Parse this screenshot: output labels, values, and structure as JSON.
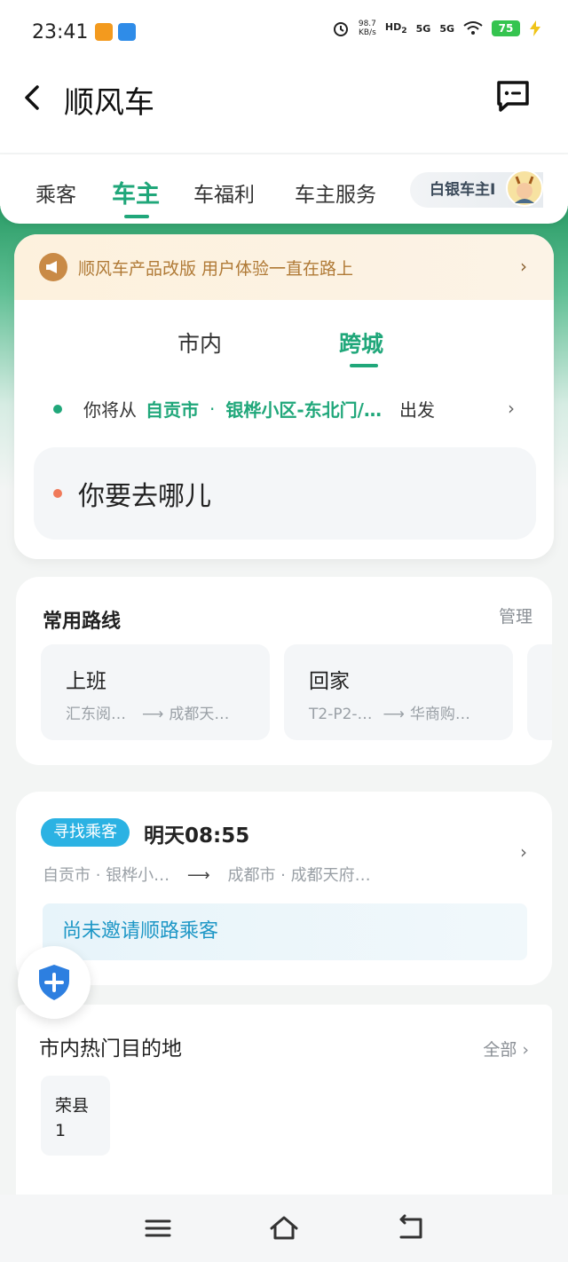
{
  "status_bar": {
    "time": "23:41",
    "speed_value": "98.7",
    "speed_unit": "KB/s",
    "hd": "HD",
    "hd_sub": "2",
    "sim1": "5G",
    "sim2": "5G",
    "battery": "75"
  },
  "header": {
    "title": "顺风车"
  },
  "tabs": [
    {
      "label": "乘客",
      "active": false
    },
    {
      "label": "车主",
      "active": true
    },
    {
      "label": "车福利",
      "active": false
    },
    {
      "label": "车主服务",
      "active": false
    }
  ],
  "level_chip": "白银车主I",
  "notice": {
    "text": "顺风车产品改版 用户体验一直在路上"
  },
  "mode_tabs": [
    {
      "label": "市内",
      "active": false
    },
    {
      "label": "跨城",
      "active": true
    }
  ],
  "from": {
    "prefix": "你将从",
    "city": "自贡市",
    "separator": "·",
    "place": "银桦小区-东北门/…",
    "suffix": "出发"
  },
  "destination": {
    "placeholder": "你要去哪儿"
  },
  "common_routes": {
    "title": "常用路线",
    "manage": "管理",
    "items": [
      {
        "title": "上班",
        "from": "汇东阅…",
        "to": "成都天…"
      },
      {
        "title": "回家",
        "from": "T2-P2-…",
        "to": "华商购…"
      }
    ]
  },
  "trip": {
    "badge": "寻找乘客",
    "time": "明天08:55",
    "from": "自贡市 · 银桦小…",
    "to": "成都市 · 成都天府…",
    "invite": "尚未邀请顺路乘客"
  },
  "hot_destinations": {
    "title": "市内热门目的地",
    "all": "全部",
    "items": [
      {
        "name": "荣县",
        "count": "1"
      }
    ]
  },
  "colors": {
    "accent": "#20a77a",
    "badge_blue": "#2bb2e3",
    "notice_text": "#b07a36"
  }
}
